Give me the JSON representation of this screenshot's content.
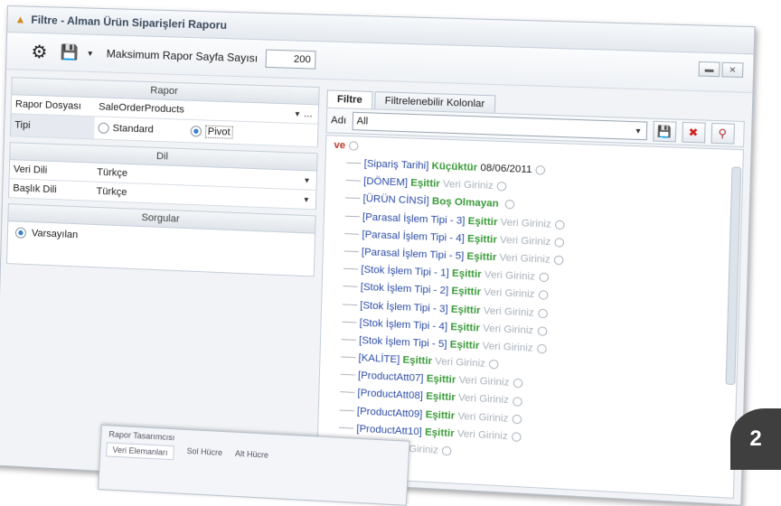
{
  "window": {
    "title": "Filtre - Alman Ürün Siparişleri Raporu"
  },
  "toolbar": {
    "max_label": "Maksimum Rapor Sayfa Sayısı",
    "max_value": "200"
  },
  "rapor": {
    "header": "Rapor",
    "file_label": "Rapor Dosyası",
    "file_value": "SaleOrderProducts",
    "file_more": "...",
    "type_label": "Tipi",
    "type_standard": "Standard",
    "type_pivot": "Pivot",
    "type_selected": "Pivot"
  },
  "dil": {
    "header": "Dil",
    "data_label": "Veri Dili",
    "data_value": "Türkçe",
    "title_label": "Başlık Dili",
    "title_value": "Türkçe"
  },
  "sorgular": {
    "header": "Sorgular",
    "item": "Varsayılan"
  },
  "tabs": [
    {
      "label": "Filtre",
      "active": true
    },
    {
      "label": "Filtrelenebilir Kolonlar",
      "active": false
    }
  ],
  "filter": {
    "name_label": "Adı",
    "name_value": "All"
  },
  "tree": {
    "root": "ve",
    "nodes": [
      {
        "field": "[Sipariş Tarihi]",
        "op": "Küçüktür",
        "value": "08/06/2011",
        "real": true
      },
      {
        "field": "[DÖNEM]",
        "op": "Eşittir",
        "value": "Veri Giriniz",
        "real": false
      },
      {
        "field": "[ÜRÜN CİNSİ]",
        "op": "Boş Olmayan",
        "value": "",
        "real": false
      },
      {
        "field": "[Parasal İşlem Tipi - 3]",
        "op": "Eşittir",
        "value": "Veri Giriniz",
        "real": false
      },
      {
        "field": "[Parasal İşlem Tipi - 4]",
        "op": "Eşittir",
        "value": "Veri Giriniz",
        "real": false
      },
      {
        "field": "[Parasal İşlem Tipi - 5]",
        "op": "Eşittir",
        "value": "Veri Giriniz",
        "real": false
      },
      {
        "field": "[Stok İşlem Tipi - 1]",
        "op": "Eşittir",
        "value": "Veri Giriniz",
        "real": false
      },
      {
        "field": "[Stok İşlem Tipi - 2]",
        "op": "Eşittir",
        "value": "Veri Giriniz",
        "real": false
      },
      {
        "field": "[Stok İşlem Tipi - 3]",
        "op": "Eşittir",
        "value": "Veri Giriniz",
        "real": false
      },
      {
        "field": "[Stok İşlem Tipi - 4]",
        "op": "Eşittir",
        "value": "Veri Giriniz",
        "real": false
      },
      {
        "field": "[Stok İşlem Tipi - 5]",
        "op": "Eşittir",
        "value": "Veri Giriniz",
        "real": false
      },
      {
        "field": "[KALİTE]",
        "op": "Eşittir",
        "value": "Veri Giriniz",
        "real": false
      },
      {
        "field": "[ProductAtt07]",
        "op": "Eşittir",
        "value": "Veri Giriniz",
        "real": false
      },
      {
        "field": "[ProductAtt08]",
        "op": "Eşittir",
        "value": "Veri Giriniz",
        "real": false
      },
      {
        "field": "[ProductAtt09]",
        "op": "Eşittir",
        "value": "Veri Giriniz",
        "real": false
      },
      {
        "field": "[ProductAtt10]",
        "op": "Eşittir",
        "value": "Veri Giriniz",
        "real": false
      },
      {
        "field": "",
        "op": "Eşittir",
        "value": "Veri Giriniz",
        "real": false
      }
    ]
  },
  "subwindow": {
    "title": "Rapor Tasarımcısı",
    "tab1": "Veri Elemanları",
    "tab2": "Sol Hücre",
    "tab3": "Alt Hücre"
  },
  "badge": {
    "number": "2"
  }
}
